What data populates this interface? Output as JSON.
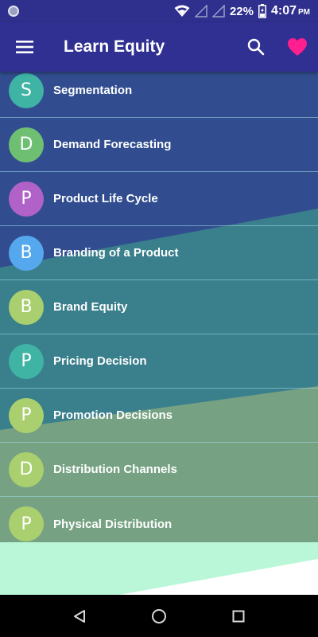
{
  "status_bar": {
    "battery": "22%",
    "time": "4:07",
    "ampm": "PM"
  },
  "app_bar": {
    "title": "Learn Equity",
    "icons": [
      "menu-icon",
      "search-icon",
      "heart-icon"
    ],
    "heart_color": "#ff1f8e"
  },
  "topics": [
    {
      "letter": "S",
      "label": "Segmentation",
      "color": "#3fb3a4"
    },
    {
      "letter": "D",
      "label": "Demand Forecasting",
      "color": "#6fbf73"
    },
    {
      "letter": "P",
      "label": "Product Life Cycle",
      "color": "#b062c8"
    },
    {
      "letter": "B",
      "label": "Branding of a Product",
      "color": "#55a8ee"
    },
    {
      "letter": "B",
      "label": "Brand Equity",
      "color": "#a9cf6e"
    },
    {
      "letter": "P",
      "label": "Pricing Decision",
      "color": "#3fb3a4"
    },
    {
      "letter": "P",
      "label": "Promotion Decisions",
      "color": "#a9cf6e"
    },
    {
      "letter": "D",
      "label": "Distribution Channels",
      "color": "#a9cf6e"
    },
    {
      "letter": "P",
      "label": "Physical Distribution",
      "color": "#a9cf6e"
    }
  ],
  "nav_bar": {
    "icons": [
      "back-icon",
      "home-icon",
      "recents-icon"
    ]
  }
}
